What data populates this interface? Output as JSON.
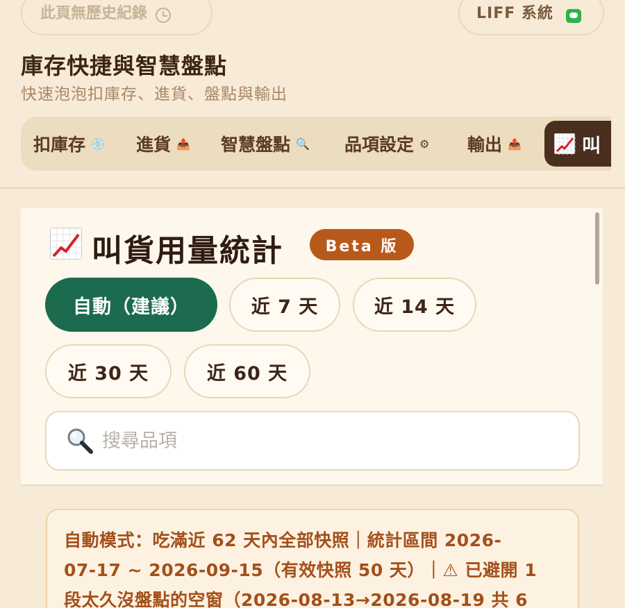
{
  "header": {
    "history_label": "此頁無歷史紀錄",
    "liff_label": "LIFF 系統",
    "title": "庫存快捷與智慧盤點",
    "subtitle": "快速泡泡扣庫存、進貨、盤點與輸出"
  },
  "tabs": [
    {
      "label": "扣庫存",
      "icon": "💿"
    },
    {
      "label": "進貨",
      "icon": "📤"
    },
    {
      "label": "智慧盤點",
      "icon": "🔍"
    },
    {
      "label": "品項設定",
      "icon": "⚙"
    },
    {
      "label": "輸出",
      "icon": "📤"
    }
  ],
  "active_tab": {
    "label": "叫",
    "icon": "chart-increasing-icon"
  },
  "stats": {
    "title": "叫貨用量統計",
    "badge": "Beta 版",
    "ranges": [
      "自動（建議）",
      "近 7 天",
      "近 14 天",
      "近 30 天",
      "近 60 天"
    ],
    "active_range": "自動（建議）"
  },
  "search": {
    "placeholder": "搜尋品項",
    "value": ""
  },
  "info_lines": [
    "自動模式：吃滿近 62 天內全部快照｜統計區間 2026-",
    "07-17 ~ 2026-09-15（有效快照 50 天）｜⚠ 已避開 1",
    "段太久沒盤點的空窗（2026-08-13→2026-08-19 共 6"
  ],
  "colors": {
    "background": "#f7ead6",
    "active_tab": "#4a2e1e",
    "active_range": "#1c6b4f",
    "badge": "#b8591c",
    "info_text": "#a3501a"
  }
}
